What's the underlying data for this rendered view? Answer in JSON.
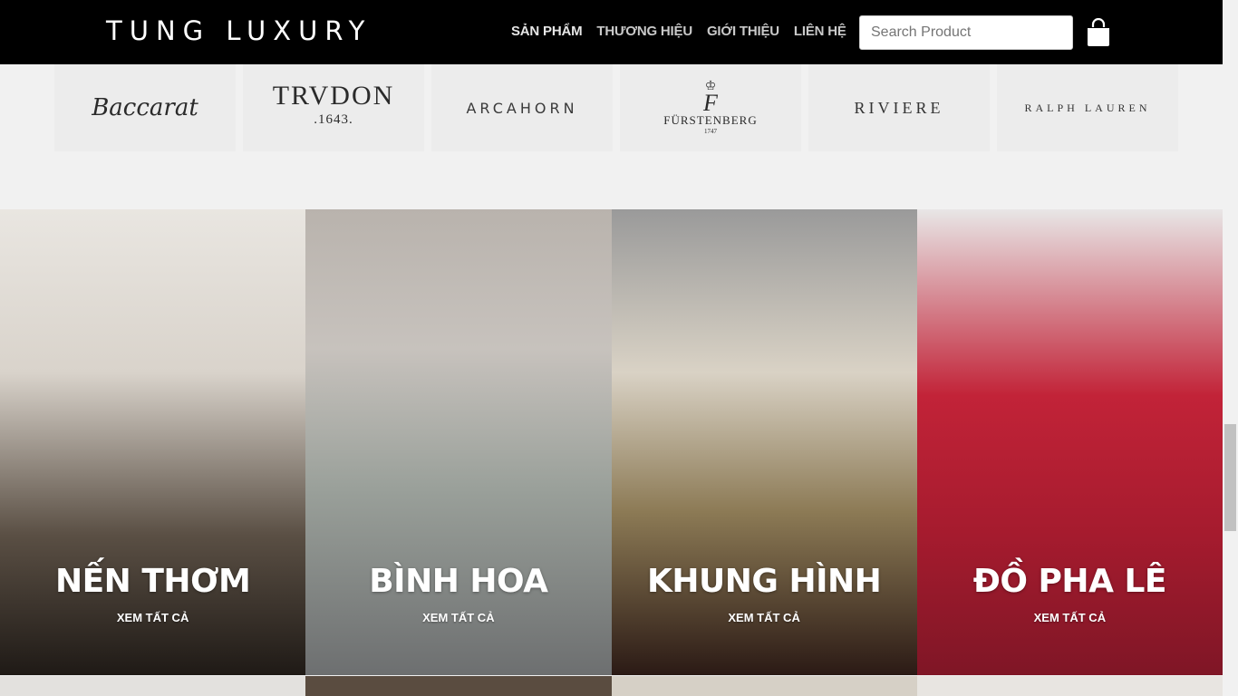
{
  "header": {
    "logo": "TUNG LUXURY",
    "nav": [
      "SẢN PHẨM",
      "THƯƠNG HIỆU",
      "GIỚI THIỆU",
      "LIÊN HỆ"
    ],
    "search_placeholder": "Search Product",
    "search_value": ""
  },
  "brands": {
    "baccarat": "Baccarat",
    "trudon": "TRVDON",
    "trudon_year": ".1643.",
    "arcahorn": "ARCAHORN",
    "furstenberg_crown": "♔",
    "furstenberg_mark": "F",
    "furstenberg": "FÜRSTENBERG",
    "furstenberg_year": "1747",
    "riviere": "RIVIERE",
    "ralph": "RALPH LAUREN"
  },
  "categories": [
    {
      "title": "NẾN THƠM",
      "link": "XEM TẤT CẢ"
    },
    {
      "title": "BÌNH HOA",
      "link": "XEM TẤT CẢ"
    },
    {
      "title": "KHUNG HÌNH",
      "link": "XEM TẤT CẢ"
    },
    {
      "title": "ĐỒ PHA LÊ",
      "link": "XEM TẤT CẢ"
    }
  ],
  "colors": {
    "header_bg": "#000000",
    "page_bg": "#f1f1f1"
  }
}
